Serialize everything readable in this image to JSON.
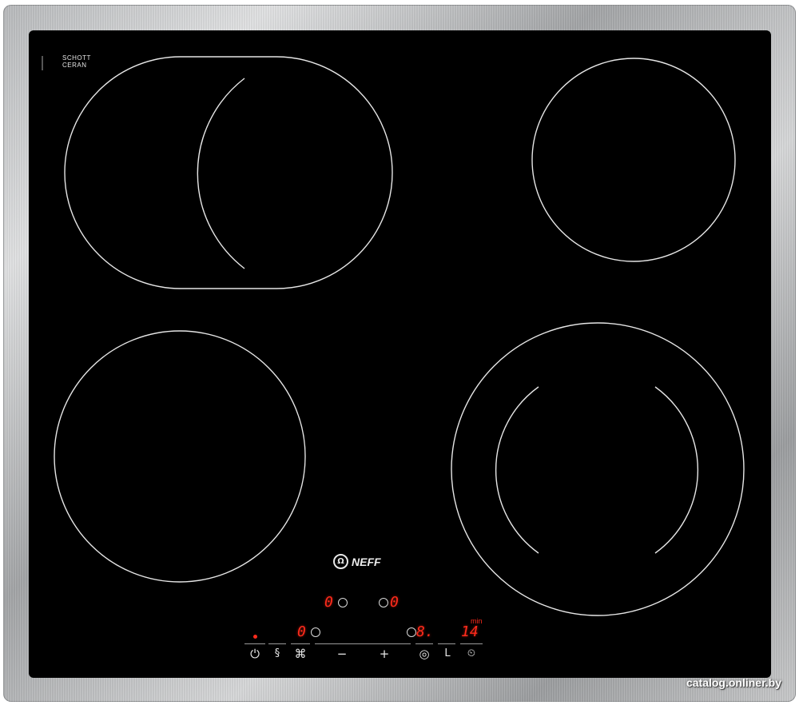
{
  "brand": {
    "logo_text": "NEFF"
  },
  "glass_label": {
    "line1": "SCHOTT",
    "line2": "CERAN"
  },
  "display": {
    "zone_left_level": "0",
    "zone_right_level": "0",
    "left_control_level": "0",
    "right_control_level": "8.",
    "timer_value": "14",
    "timer_unit": "min"
  },
  "controls": {
    "power_symbol": "⏻",
    "wipe_symbol": "§",
    "lock_symbol": "⌘",
    "minus_symbol": "−",
    "plus_symbol": "+",
    "zone_select_symbol": "◎",
    "warm_symbol": "L",
    "timer_symbol": "⏲"
  },
  "icons": [
    "power-icon",
    "wipe-protect-icon",
    "child-lock-icon",
    "minus-icon",
    "plus-icon",
    "zone-select-icon",
    "keep-warm-icon",
    "timer-icon"
  ],
  "colors": {
    "glass": "#000000",
    "display_red": "#ff2b1c",
    "frame": "#b9bbbd"
  },
  "watermark": "catalog.onliner.by"
}
